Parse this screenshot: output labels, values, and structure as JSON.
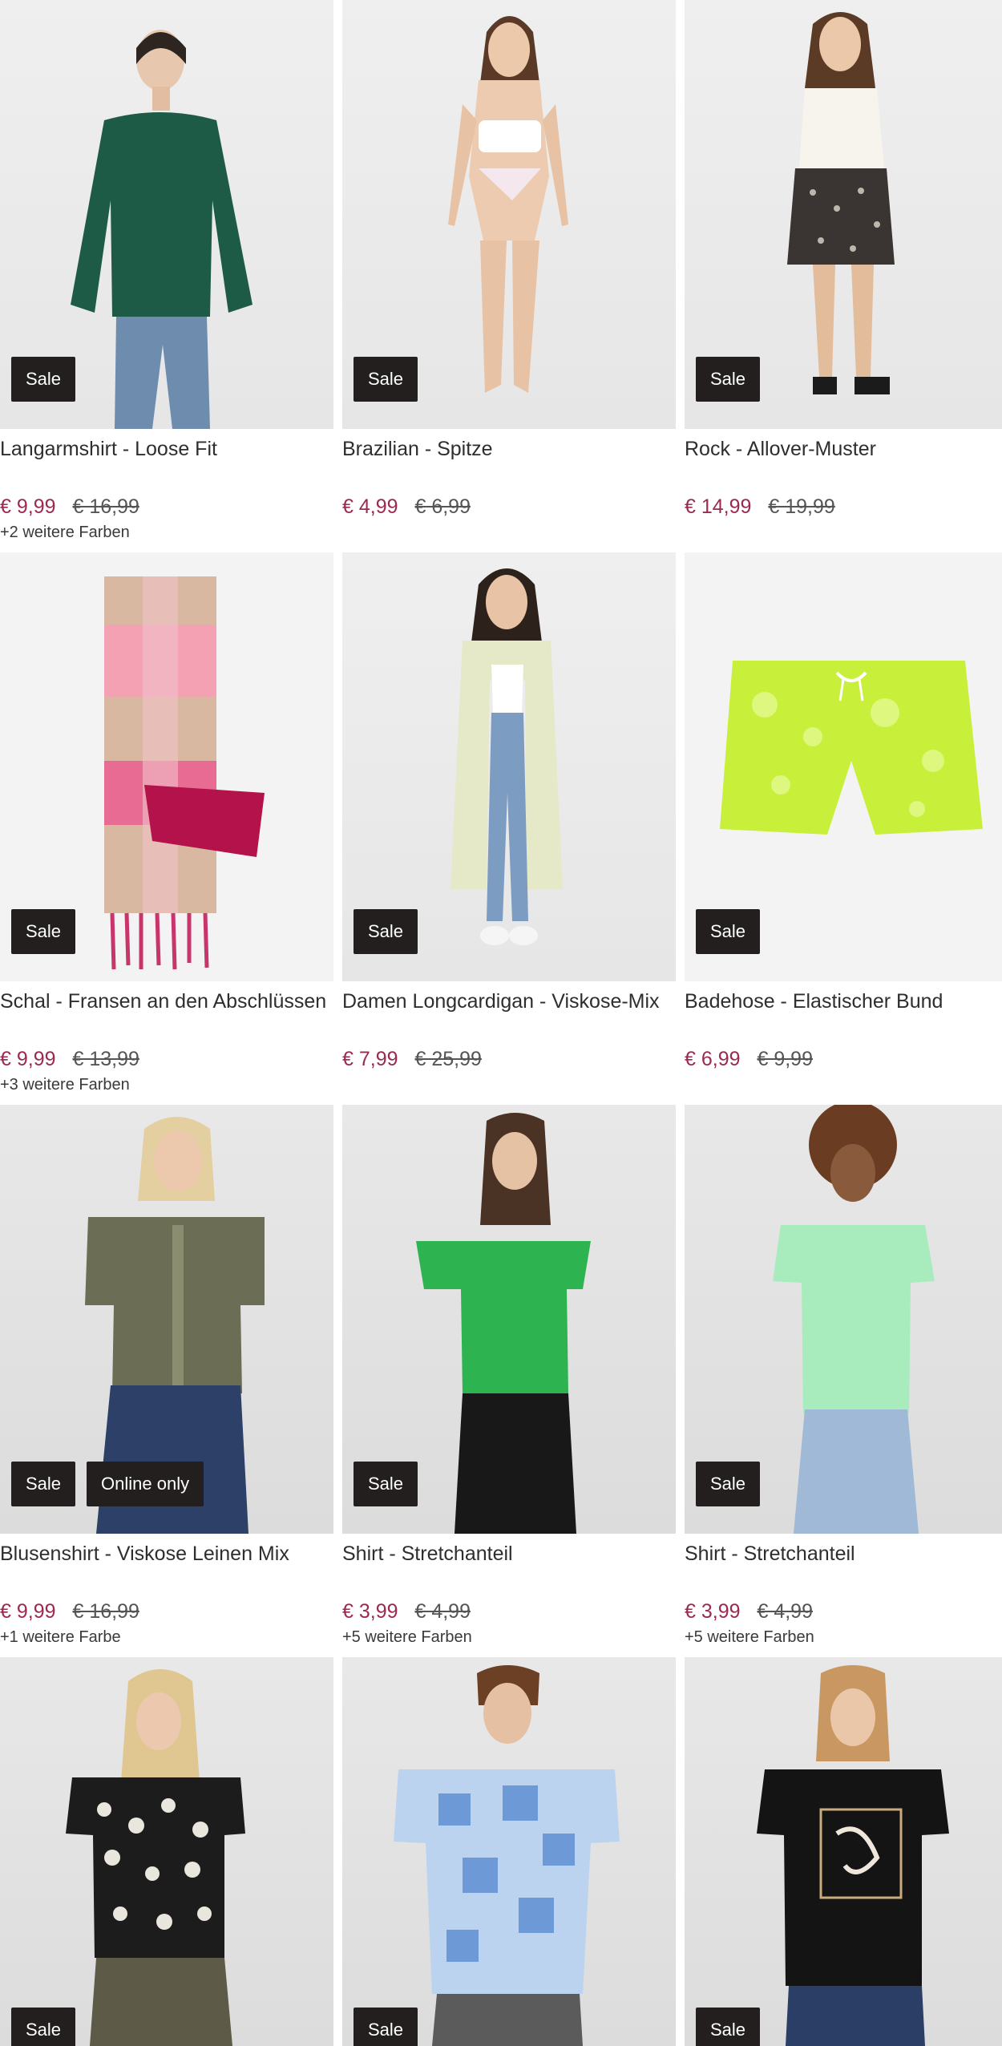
{
  "products": [
    {
      "title": "Langarmshirt - Loose Fit",
      "price": "€ 9,99",
      "old_price": "€ 16,99",
      "colors": "+2 weitere Farben",
      "badges": [
        "Sale"
      ]
    },
    {
      "title": "Brazilian - Spitze",
      "price": "€ 4,99",
      "old_price": "€ 6,99",
      "colors": "",
      "badges": [
        "Sale"
      ]
    },
    {
      "title": "Rock - Allover-Muster",
      "price": "€ 14,99",
      "old_price": "€ 19,99",
      "colors": "",
      "badges": [
        "Sale"
      ]
    },
    {
      "title": "Schal - Fransen an den Abschlüssen",
      "price": "€ 9,99",
      "old_price": "€ 13,99",
      "colors": "+3 weitere Farben",
      "badges": [
        "Sale"
      ]
    },
    {
      "title": "Damen Longcardigan - Viskose-Mix",
      "price": "€ 7,99",
      "old_price": "€ 25,99",
      "colors": "",
      "badges": [
        "Sale"
      ]
    },
    {
      "title": "Badehose - Elastischer Bund",
      "price": "€ 6,99",
      "old_price": "€ 9,99",
      "colors": "",
      "badges": [
        "Sale"
      ]
    },
    {
      "title": "Blusenshirt - Viskose Leinen Mix",
      "price": "€ 9,99",
      "old_price": "€ 16,99",
      "colors": "+1 weitere Farbe",
      "badges": [
        "Sale",
        "Online only"
      ]
    },
    {
      "title": "Shirt - Stretchanteil",
      "price": "€ 3,99",
      "old_price": "€ 4,99",
      "colors": "+5 weitere Farben",
      "badges": [
        "Sale"
      ]
    },
    {
      "title": "Shirt - Stretchanteil",
      "price": "€ 3,99",
      "old_price": "€ 4,99",
      "colors": "+5 weitere Farben",
      "badges": [
        "Sale"
      ]
    },
    {
      "title": "",
      "price": "",
      "old_price": "",
      "colors": "",
      "badges": [
        "Sale"
      ]
    },
    {
      "title": "",
      "price": "",
      "old_price": "",
      "colors": "",
      "badges": [
        "Sale"
      ]
    },
    {
      "title": "",
      "price": "",
      "old_price": "",
      "colors": "",
      "badges": [
        "Sale"
      ]
    }
  ],
  "colors": {
    "sale_price": "#9b2a4e",
    "badge_bg": "#231f1f",
    "badge_text": "#ffffff"
  },
  "product_images": [
    {
      "icon": "green-longsleeve-model-image"
    },
    {
      "icon": "lace-brazilian-model-image"
    },
    {
      "icon": "patterned-skirt-model-image"
    },
    {
      "icon": "pink-checked-scarf-image"
    },
    {
      "icon": "long-cardigan-model-image"
    },
    {
      "icon": "neon-swim-shorts-image"
    },
    {
      "icon": "olive-blouse-model-image"
    },
    {
      "icon": "green-tshirt-model-image"
    },
    {
      "icon": "mint-tshirt-model-image"
    },
    {
      "icon": "leopard-tshirt-model-image"
    },
    {
      "icon": "blue-patchwork-tshirt-model-image"
    },
    {
      "icon": "black-print-tshirt-model-image"
    }
  ]
}
